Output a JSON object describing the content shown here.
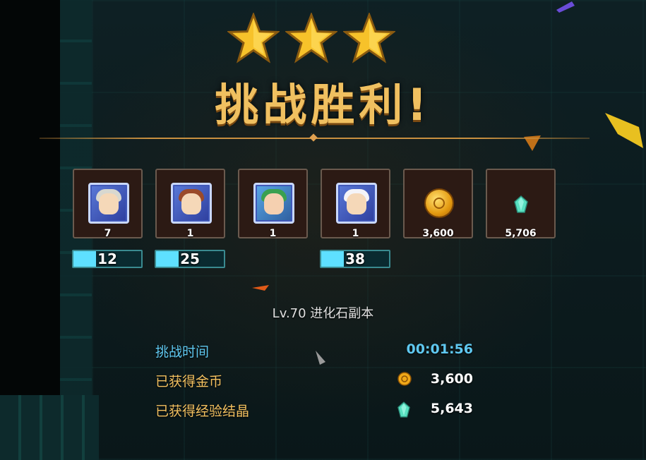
{
  "result": {
    "stars": 3,
    "title": "挑战胜利!"
  },
  "rewards": [
    {
      "kind": "hero",
      "icon": "hero-silver-hair-portrait",
      "count": "7",
      "level": "12",
      "progress": 0.33
    },
    {
      "kind": "hero",
      "icon": "hero-brown-hair-portrait",
      "count": "1",
      "level": "25",
      "progress": 0.33
    },
    {
      "kind": "hero",
      "icon": "hero-green-hair-portrait",
      "count": "1"
    },
    {
      "kind": "hero",
      "icon": "hero-blonde-hair-portrait",
      "count": "1",
      "level": "38",
      "progress": 0.33
    },
    {
      "kind": "currency",
      "icon": "gold-coin-icon",
      "count": "3,600"
    },
    {
      "kind": "currency",
      "icon": "exp-crystal-icon",
      "count": "5,706"
    }
  ],
  "stage": {
    "name": "Lv.70  进化石副本"
  },
  "stats": {
    "time_label": "挑战时间",
    "time_value": "00:01:56",
    "gold_label": "已获得金币",
    "gold_value": "3,600",
    "exp_label": "已获得经验结晶",
    "exp_value": "5,643"
  },
  "colors": {
    "title_gold": "#f0c060",
    "label_gold": "#f2c060",
    "label_blue": "#5fc8f0",
    "level_fill": "#5ee0ff"
  }
}
